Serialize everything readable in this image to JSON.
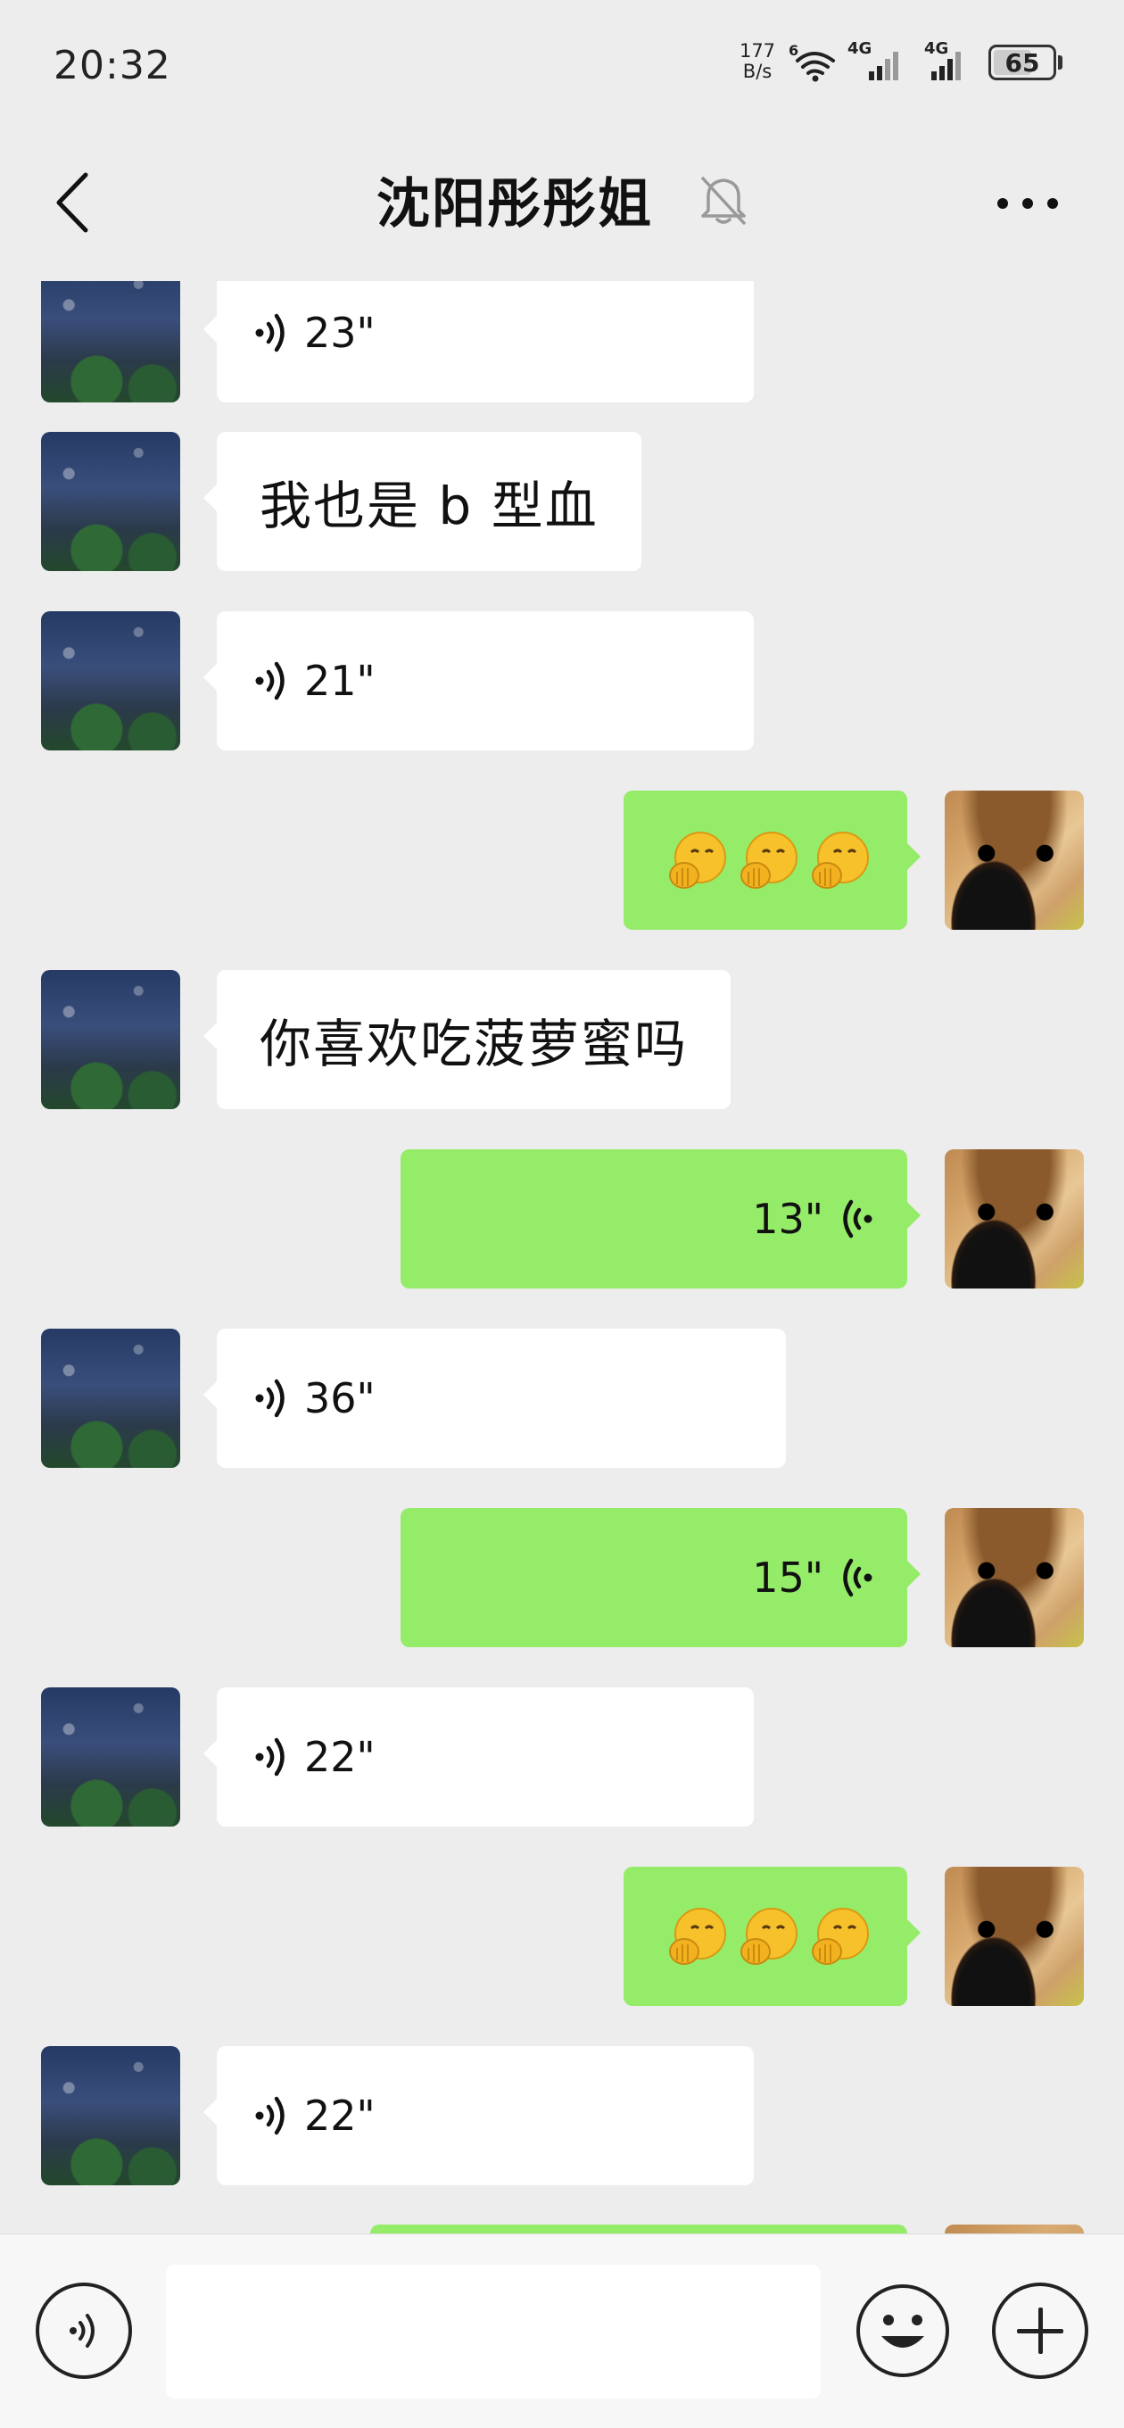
{
  "status_bar": {
    "time": "20:32",
    "net_speed_value": "177",
    "net_speed_unit": "B/s",
    "wifi_badge": "6",
    "signal_1_label": "4G",
    "signal_2_label": "4G",
    "battery_level": "65",
    "icons": [
      "wifi-icon",
      "signal-icon",
      "signal-icon",
      "battery-icon"
    ]
  },
  "header": {
    "title": "沈阳彤彤姐",
    "icons": [
      "back-arrow-icon",
      "mute-bell-icon",
      "more-dots-icon"
    ]
  },
  "messages": [
    {
      "side": "in",
      "type": "voice",
      "duration": "23\""
    },
    {
      "side": "in",
      "type": "text",
      "text": "我也是 b 型血"
    },
    {
      "side": "in",
      "type": "voice",
      "duration": "21\""
    },
    {
      "side": "out",
      "type": "emoji",
      "emoji": "🤭🤭🤭"
    },
    {
      "side": "in",
      "type": "text",
      "text": "你喜欢吃菠萝蜜吗"
    },
    {
      "side": "out",
      "type": "voice",
      "duration": "13\""
    },
    {
      "side": "in",
      "type": "voice",
      "duration": "36\""
    },
    {
      "side": "out",
      "type": "voice",
      "duration": "15\""
    },
    {
      "side": "in",
      "type": "voice",
      "duration": "22\""
    },
    {
      "side": "out",
      "type": "emoji",
      "emoji": "🤭🤭🤭"
    },
    {
      "side": "in",
      "type": "voice",
      "duration": "22\""
    }
  ],
  "input_bar": {
    "placeholder": "",
    "icons": [
      "voice-toggle-icon",
      "emoji-icon",
      "plus-icon"
    ]
  },
  "colors": {
    "background": "#ededed",
    "outgoing_bubble": "#95ec69",
    "incoming_bubble": "#ffffff"
  }
}
